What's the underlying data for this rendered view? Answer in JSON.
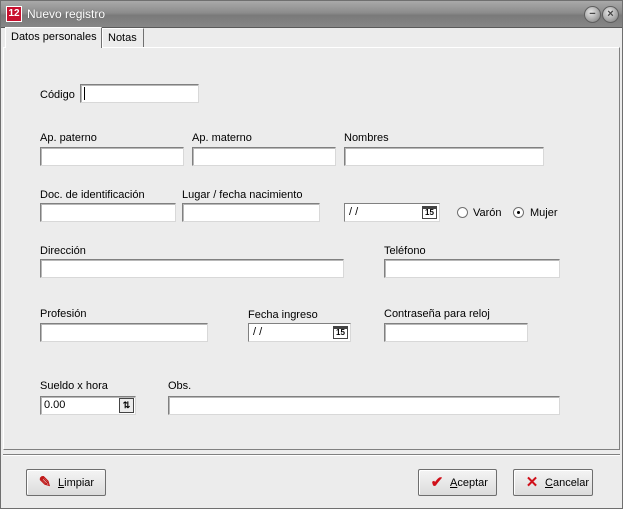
{
  "window": {
    "title": "Nuevo registro"
  },
  "tabs": [
    {
      "label": "Datos personales",
      "active": true
    },
    {
      "label": "Notas",
      "active": false
    }
  ],
  "form": {
    "codigo": {
      "label": "Código",
      "value": ""
    },
    "ap_paterno": {
      "label": "Ap. paterno",
      "value": ""
    },
    "ap_materno": {
      "label": "Ap. materno",
      "value": ""
    },
    "nombres": {
      "label": "Nombres",
      "value": ""
    },
    "doc_identificacion": {
      "label": "Doc. de identificación",
      "value": ""
    },
    "lugar_nacimiento": {
      "label": "Lugar / fecha nacimiento",
      "value": ""
    },
    "fecha_nacimiento": {
      "value": " /  /",
      "calendar_icon_text": "15"
    },
    "sexo": {
      "options": [
        {
          "label": "Varón",
          "checked": false
        },
        {
          "label": "Mujer",
          "checked": true
        }
      ]
    },
    "direccion": {
      "label": "Dirección",
      "value": ""
    },
    "telefono": {
      "label": "Teléfono",
      "value": ""
    },
    "profesion": {
      "label": "Profesión",
      "value": ""
    },
    "fecha_ingreso": {
      "label": "Fecha ingreso",
      "value": " /  /",
      "calendar_icon_text": "15"
    },
    "contrasena_reloj": {
      "label": "Contraseña para reloj",
      "value": ""
    },
    "sueldo_hora": {
      "label": "Sueldo x hora",
      "value": "0.00"
    },
    "obs": {
      "label": "Obs.",
      "value": ""
    }
  },
  "buttons": {
    "limpiar": {
      "label": "Limpiar",
      "accel": "L",
      "rest": "impiar",
      "icon": "eraser-icon"
    },
    "aceptar": {
      "label": "Aceptar",
      "accel": "A",
      "rest": "ceptar",
      "icon": "check-icon"
    },
    "cancelar": {
      "label": "Cancelar",
      "accel": "C",
      "rest": "ancelar",
      "icon": "x-icon"
    }
  },
  "colors": {
    "titlebar": "#8c8c8c",
    "window_bg": "#ececec",
    "check": "#d0101a",
    "cancel": "#d0101a"
  }
}
